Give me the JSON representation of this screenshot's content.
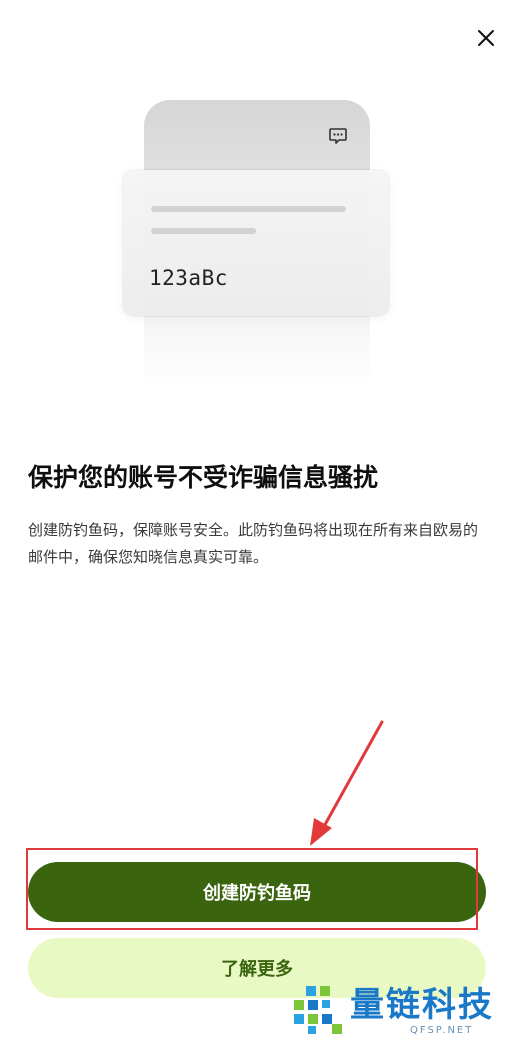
{
  "header": {
    "close_icon": "close-icon"
  },
  "illustration": {
    "code": "123aBc",
    "message_icon": "message-dots-icon"
  },
  "content": {
    "title": "保护您的账号不受诈骗信息骚扰",
    "description": "创建防钓鱼码，保障账号安全。此防钓鱼码将出现在所有来自欧易的邮件中，确保您知晓信息真实可靠。"
  },
  "actions": {
    "primary_label": "创建防钓鱼码",
    "secondary_label": "了解更多"
  },
  "watermark": {
    "name": "量链科技",
    "domain": "QFSP.NET"
  },
  "colors": {
    "primary": "#3b640f",
    "secondary_bg": "#e9f9c3",
    "highlight": "#e23a3a",
    "watermark": "#1a78c8"
  }
}
